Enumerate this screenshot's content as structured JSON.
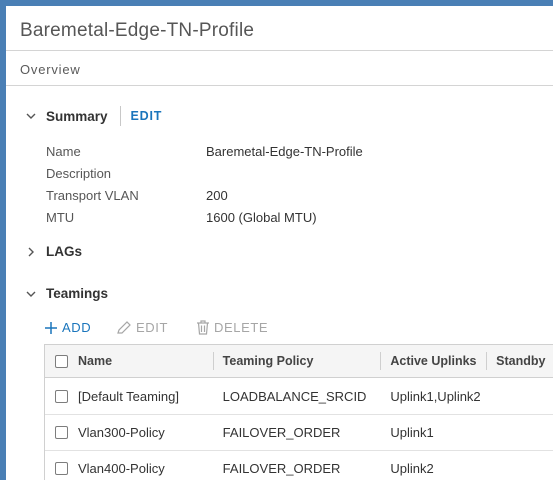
{
  "page": {
    "title": "Baremetal-Edge-TN-Profile",
    "tab": "Overview"
  },
  "summary": {
    "label": "Summary",
    "edit_label": "EDIT",
    "expanded": true,
    "properties": [
      {
        "label": "Name",
        "value": "Baremetal-Edge-TN-Profile"
      },
      {
        "label": "Description",
        "value": ""
      },
      {
        "label": "Transport VLAN",
        "value": "200"
      },
      {
        "label": "MTU",
        "value": "1600 (Global MTU)"
      }
    ]
  },
  "lags": {
    "label": "LAGs",
    "expanded": false
  },
  "teamings": {
    "label": "Teamings",
    "expanded": true,
    "actions": {
      "add": "ADD",
      "edit": "EDIT",
      "delete": "DELETE"
    },
    "columns": [
      "Name",
      "Teaming Policy",
      "Active Uplinks",
      "Standby"
    ],
    "rows": [
      {
        "name": "[Default Teaming]",
        "policy": "LOADBALANCE_SRCID",
        "active": "Uplink1,Uplink2",
        "standby": ""
      },
      {
        "name": "Vlan300-Policy",
        "policy": "FAILOVER_ORDER",
        "active": "Uplink1",
        "standby": ""
      },
      {
        "name": "Vlan400-Policy",
        "policy": "FAILOVER_ORDER",
        "active": "Uplink2",
        "standby": ""
      }
    ]
  },
  "colors": {
    "accent": "#1a75bc",
    "frame": "#4a7fb5",
    "disabled": "#a6a6a6"
  },
  "icons": {
    "expanded": "chevron-down-icon",
    "collapsed": "chevron-right-icon",
    "add": "plus-icon",
    "edit": "pencil-icon",
    "delete": "trash-icon"
  }
}
